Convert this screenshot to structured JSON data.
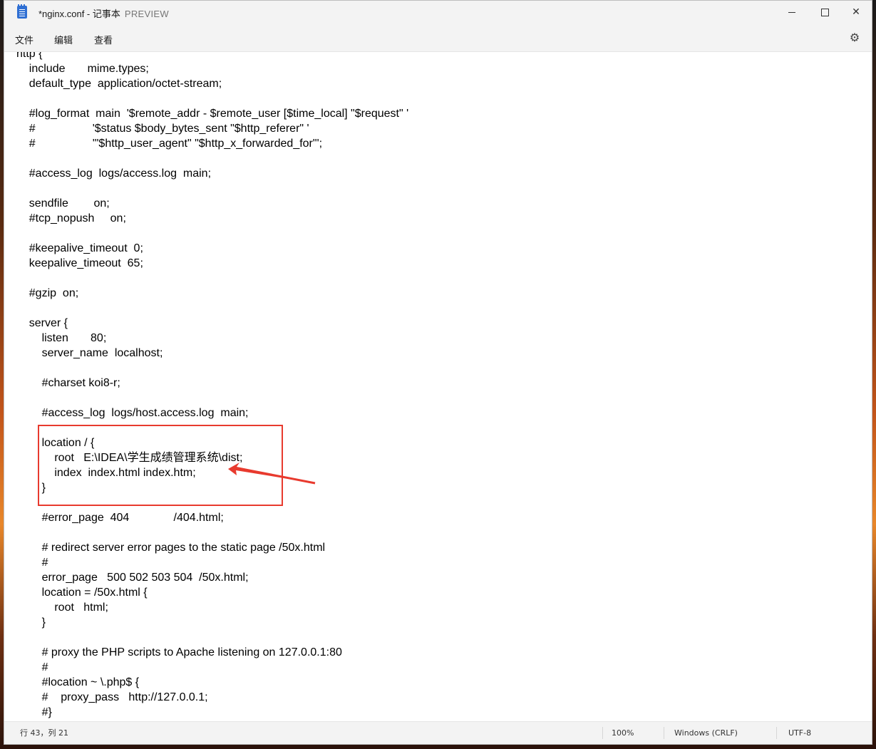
{
  "window": {
    "title": "*nginx.conf - 记事本",
    "preview_label": "PREVIEW",
    "icon": "notepad-icon",
    "controls": {
      "minimize_icon": "minimize-icon",
      "maximize_icon": "maximize-icon",
      "close_icon": "close-icon",
      "close_glyph": "✕"
    }
  },
  "menu": {
    "file": "文件",
    "edit": "编辑",
    "view": "查看",
    "settings_icon": "gear-icon",
    "settings_glyph": "⚙"
  },
  "editor": {
    "lines": [
      "http {",
      "    include       mime.types;",
      "    default_type  application/octet-stream;",
      "",
      "    #log_format  main  '$remote_addr - $remote_user [$time_local] \"$request\" '",
      "    #                  '$status $body_bytes_sent \"$http_referer\" '",
      "    #                  '\"$http_user_agent\" \"$http_x_forwarded_for\"';",
      "",
      "    #access_log  logs/access.log  main;",
      "",
      "    sendfile        on;",
      "    #tcp_nopush     on;",
      "",
      "    #keepalive_timeout  0;",
      "    keepalive_timeout  65;",
      "",
      "    #gzip  on;",
      "",
      "    server {",
      "        listen       80;",
      "        server_name  localhost;",
      "",
      "        #charset koi8-r;",
      "",
      "        #access_log  logs/host.access.log  main;",
      "",
      "        location / {",
      "            root   E:\\IDEA\\学生成绩管理系统\\dist;",
      "            index  index.html index.htm;",
      "        }",
      "",
      "        #error_page  404              /404.html;",
      "",
      "        # redirect server error pages to the static page /50x.html",
      "        #",
      "        error_page   500 502 503 504  /50x.html;",
      "        location = /50x.html {",
      "            root   html;",
      "        }",
      "",
      "        # proxy the PHP scripts to Apache listening on 127.0.0.1:80",
      "        #",
      "        #location ~ \\.php$ {",
      "        #    proxy_pass   http://127.0.0.1;",
      "        #}"
    ],
    "highlight_color": "#e83a2e"
  },
  "status": {
    "position": "行 43，列 21",
    "zoom": "100%",
    "line_ending": "Windows (CRLF)",
    "encoding": "UTF-8"
  }
}
